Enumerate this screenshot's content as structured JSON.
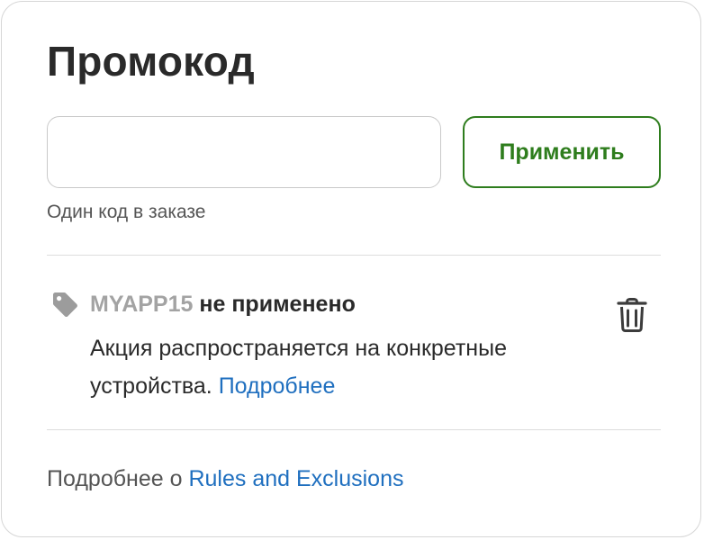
{
  "promo": {
    "title": "Промокод",
    "input": {
      "value": "",
      "placeholder": ""
    },
    "apply_label": "Применить",
    "hint": "Один код в заказе"
  },
  "applied_code": {
    "code": "MYAPP15",
    "status": "не применено",
    "description": "Акция распространяется на конкретные устройства.",
    "more_link": "Подробнее",
    "icons": {
      "tag": "tag-icon",
      "remove": "trash-icon"
    }
  },
  "footer": {
    "text": "Подробнее о",
    "link": "Rules and Exclusions"
  },
  "colors": {
    "accent_green": "#2e7d1d",
    "link_blue": "#1f6fbf",
    "muted_code_gray": "#a3a3a3",
    "text_dark": "#2a2a2a",
    "text_muted": "#555555",
    "border": "#d6d6d6"
  }
}
